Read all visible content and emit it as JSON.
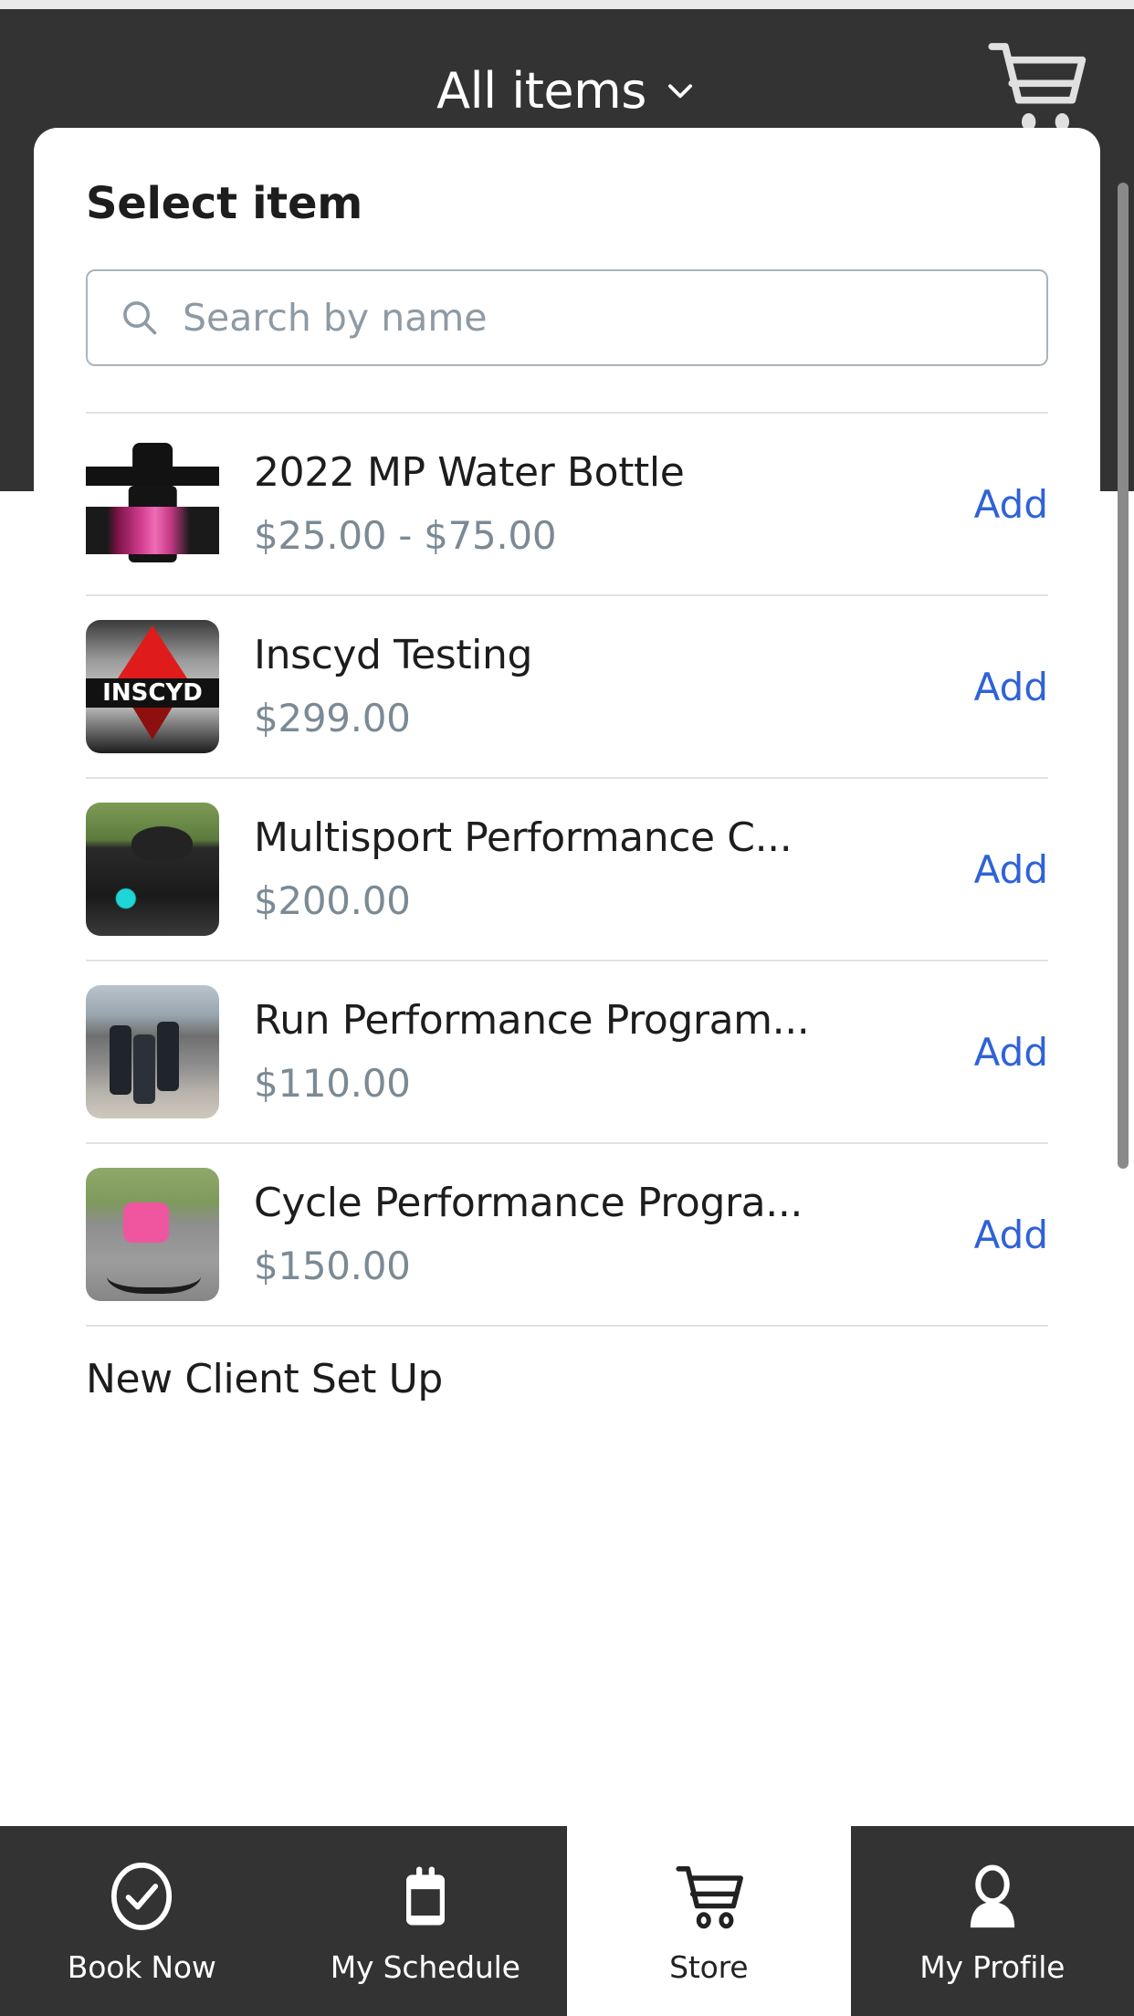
{
  "header": {
    "title": "All items",
    "dropdown_icon": "chevron-down-icon",
    "cart_icon": "shopping-cart-icon"
  },
  "sheet": {
    "title": "Select item",
    "search": {
      "placeholder": "Search by name",
      "value": "",
      "icon": "search-icon"
    },
    "add_label": "Add",
    "items": [
      {
        "name": "2022 MP Water Bottle",
        "price": "$25.00 - $75.00",
        "thumb": "water-bottle-thumbnail"
      },
      {
        "name": "Inscyd Testing",
        "price": "$299.00",
        "thumb": "inscyd-logo-thumbnail"
      },
      {
        "name": "Multisport Performance C...",
        "price": "$200.00",
        "thumb": "multisport-athletes-thumbnail"
      },
      {
        "name": "Run Performance Program...",
        "price": "$110.00",
        "thumb": "runners-thumbnail"
      },
      {
        "name": "Cycle Performance Progra...",
        "price": "$150.00",
        "thumb": "cyclist-thumbnail"
      },
      {
        "name": "New Client Set Up",
        "price": "",
        "thumb": ""
      }
    ]
  },
  "bottom_nav": [
    {
      "label": "Book Now",
      "icon": "check-circle-icon",
      "active": false
    },
    {
      "label": "My Schedule",
      "icon": "calendar-icon",
      "active": false
    },
    {
      "label": "Store",
      "icon": "shopping-cart-icon",
      "active": true
    },
    {
      "label": "My Profile",
      "icon": "person-icon",
      "active": false
    }
  ],
  "colors": {
    "header_background": "#333333",
    "accent_link": "#2f62d8",
    "price_text": "#7b8a94",
    "divider": "#dfe3e6"
  }
}
